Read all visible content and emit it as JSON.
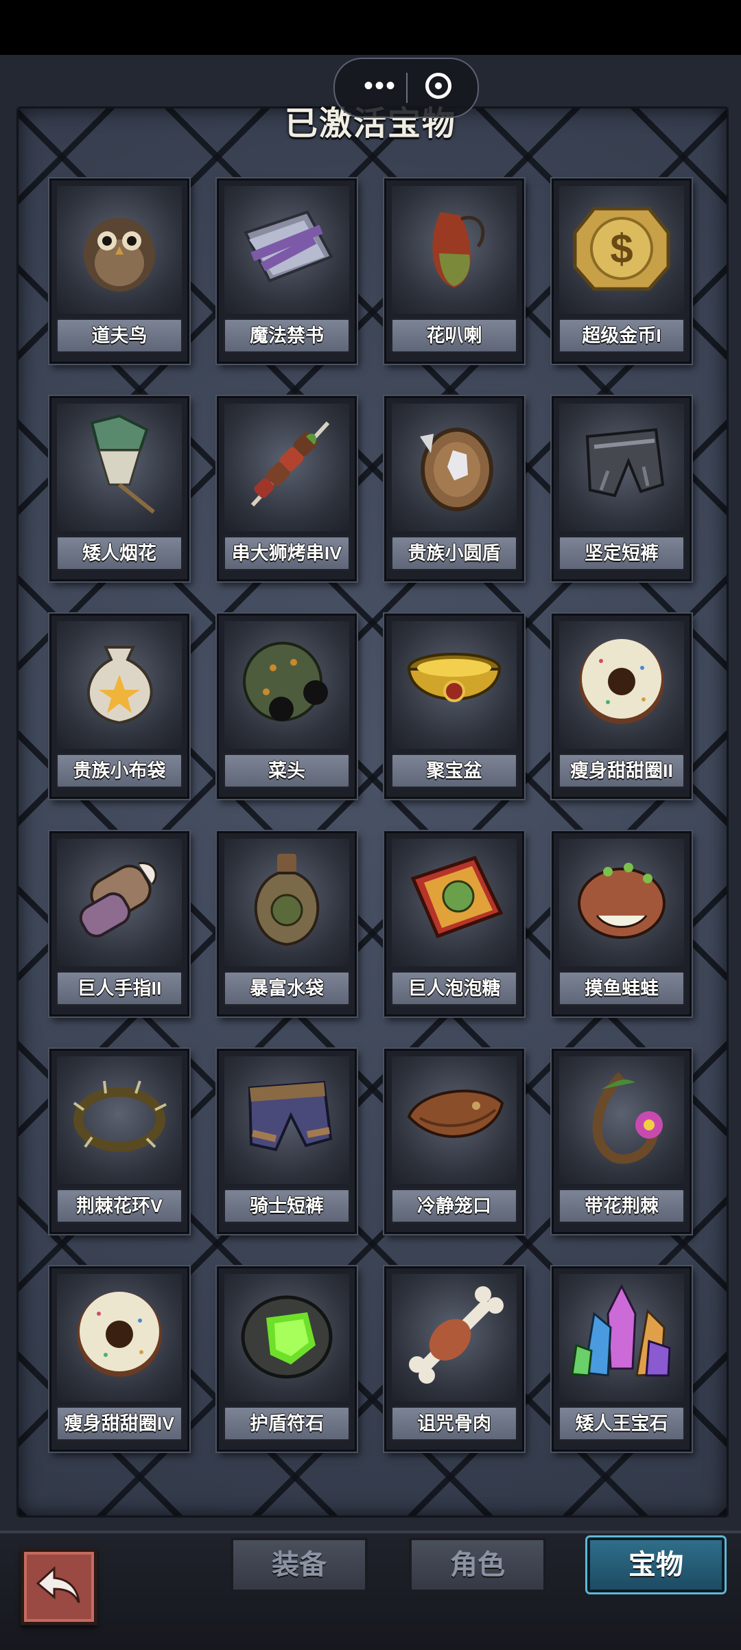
{
  "header": {
    "title": "已激活宝物"
  },
  "capsule": {
    "more_icon": "more-dots-icon",
    "close_icon": "target-close-icon",
    "more_text": "•••"
  },
  "treasures": [
    {
      "name": "道夫鸟",
      "icon": "owl-icon"
    },
    {
      "name": "魔法禁书",
      "icon": "forbidden-book-icon"
    },
    {
      "name": "花叭喇",
      "icon": "pitcher-plant-icon"
    },
    {
      "name": "超级金币I",
      "icon": "gold-coin-icon"
    },
    {
      "name": "矮人烟花",
      "icon": "firework-icon"
    },
    {
      "name": "串大狮烤串IV",
      "icon": "kebab-icon"
    },
    {
      "name": "贵族小圆盾",
      "icon": "round-shield-icon"
    },
    {
      "name": "坚定短裤",
      "icon": "iron-shorts-icon"
    },
    {
      "name": "贵族小布袋",
      "icon": "cloth-bag-icon"
    },
    {
      "name": "菜头",
      "icon": "cabbage-head-icon"
    },
    {
      "name": "聚宝盆",
      "icon": "treasure-bowl-icon"
    },
    {
      "name": "瘦身甜甜圈II",
      "icon": "donut-icon"
    },
    {
      "name": "巨人手指II",
      "icon": "giant-finger-icon"
    },
    {
      "name": "暴富水袋",
      "icon": "water-bag-icon"
    },
    {
      "name": "巨人泡泡糖",
      "icon": "bubblegum-icon"
    },
    {
      "name": "摸鱼蛙蛙",
      "icon": "frog-icon"
    },
    {
      "name": "荆棘花环V",
      "icon": "thorn-wreath-icon"
    },
    {
      "name": "骑士短裤",
      "icon": "knight-shorts-icon"
    },
    {
      "name": "冷静笼口",
      "icon": "muzzle-icon"
    },
    {
      "name": "带花荆棘",
      "icon": "flower-thorn-icon"
    },
    {
      "name": "瘦身甜甜圈IV",
      "icon": "donut-icon"
    },
    {
      "name": "护盾符石",
      "icon": "shield-rune-icon"
    },
    {
      "name": "诅咒骨肉",
      "icon": "cursed-bone-icon"
    },
    {
      "name": "矮人王宝石",
      "icon": "crystal-cluster-icon"
    }
  ],
  "bottom_nav": {
    "back_icon": "back-arrow-icon",
    "tabs": [
      {
        "label": "装备",
        "active": false
      },
      {
        "label": "角色",
        "active": false
      },
      {
        "label": "宝物",
        "active": true
      }
    ]
  },
  "colors": {
    "accent": "#2f6e8a",
    "panel": "#3c4454",
    "label": "#6b7385",
    "back": "#9a4a42"
  }
}
